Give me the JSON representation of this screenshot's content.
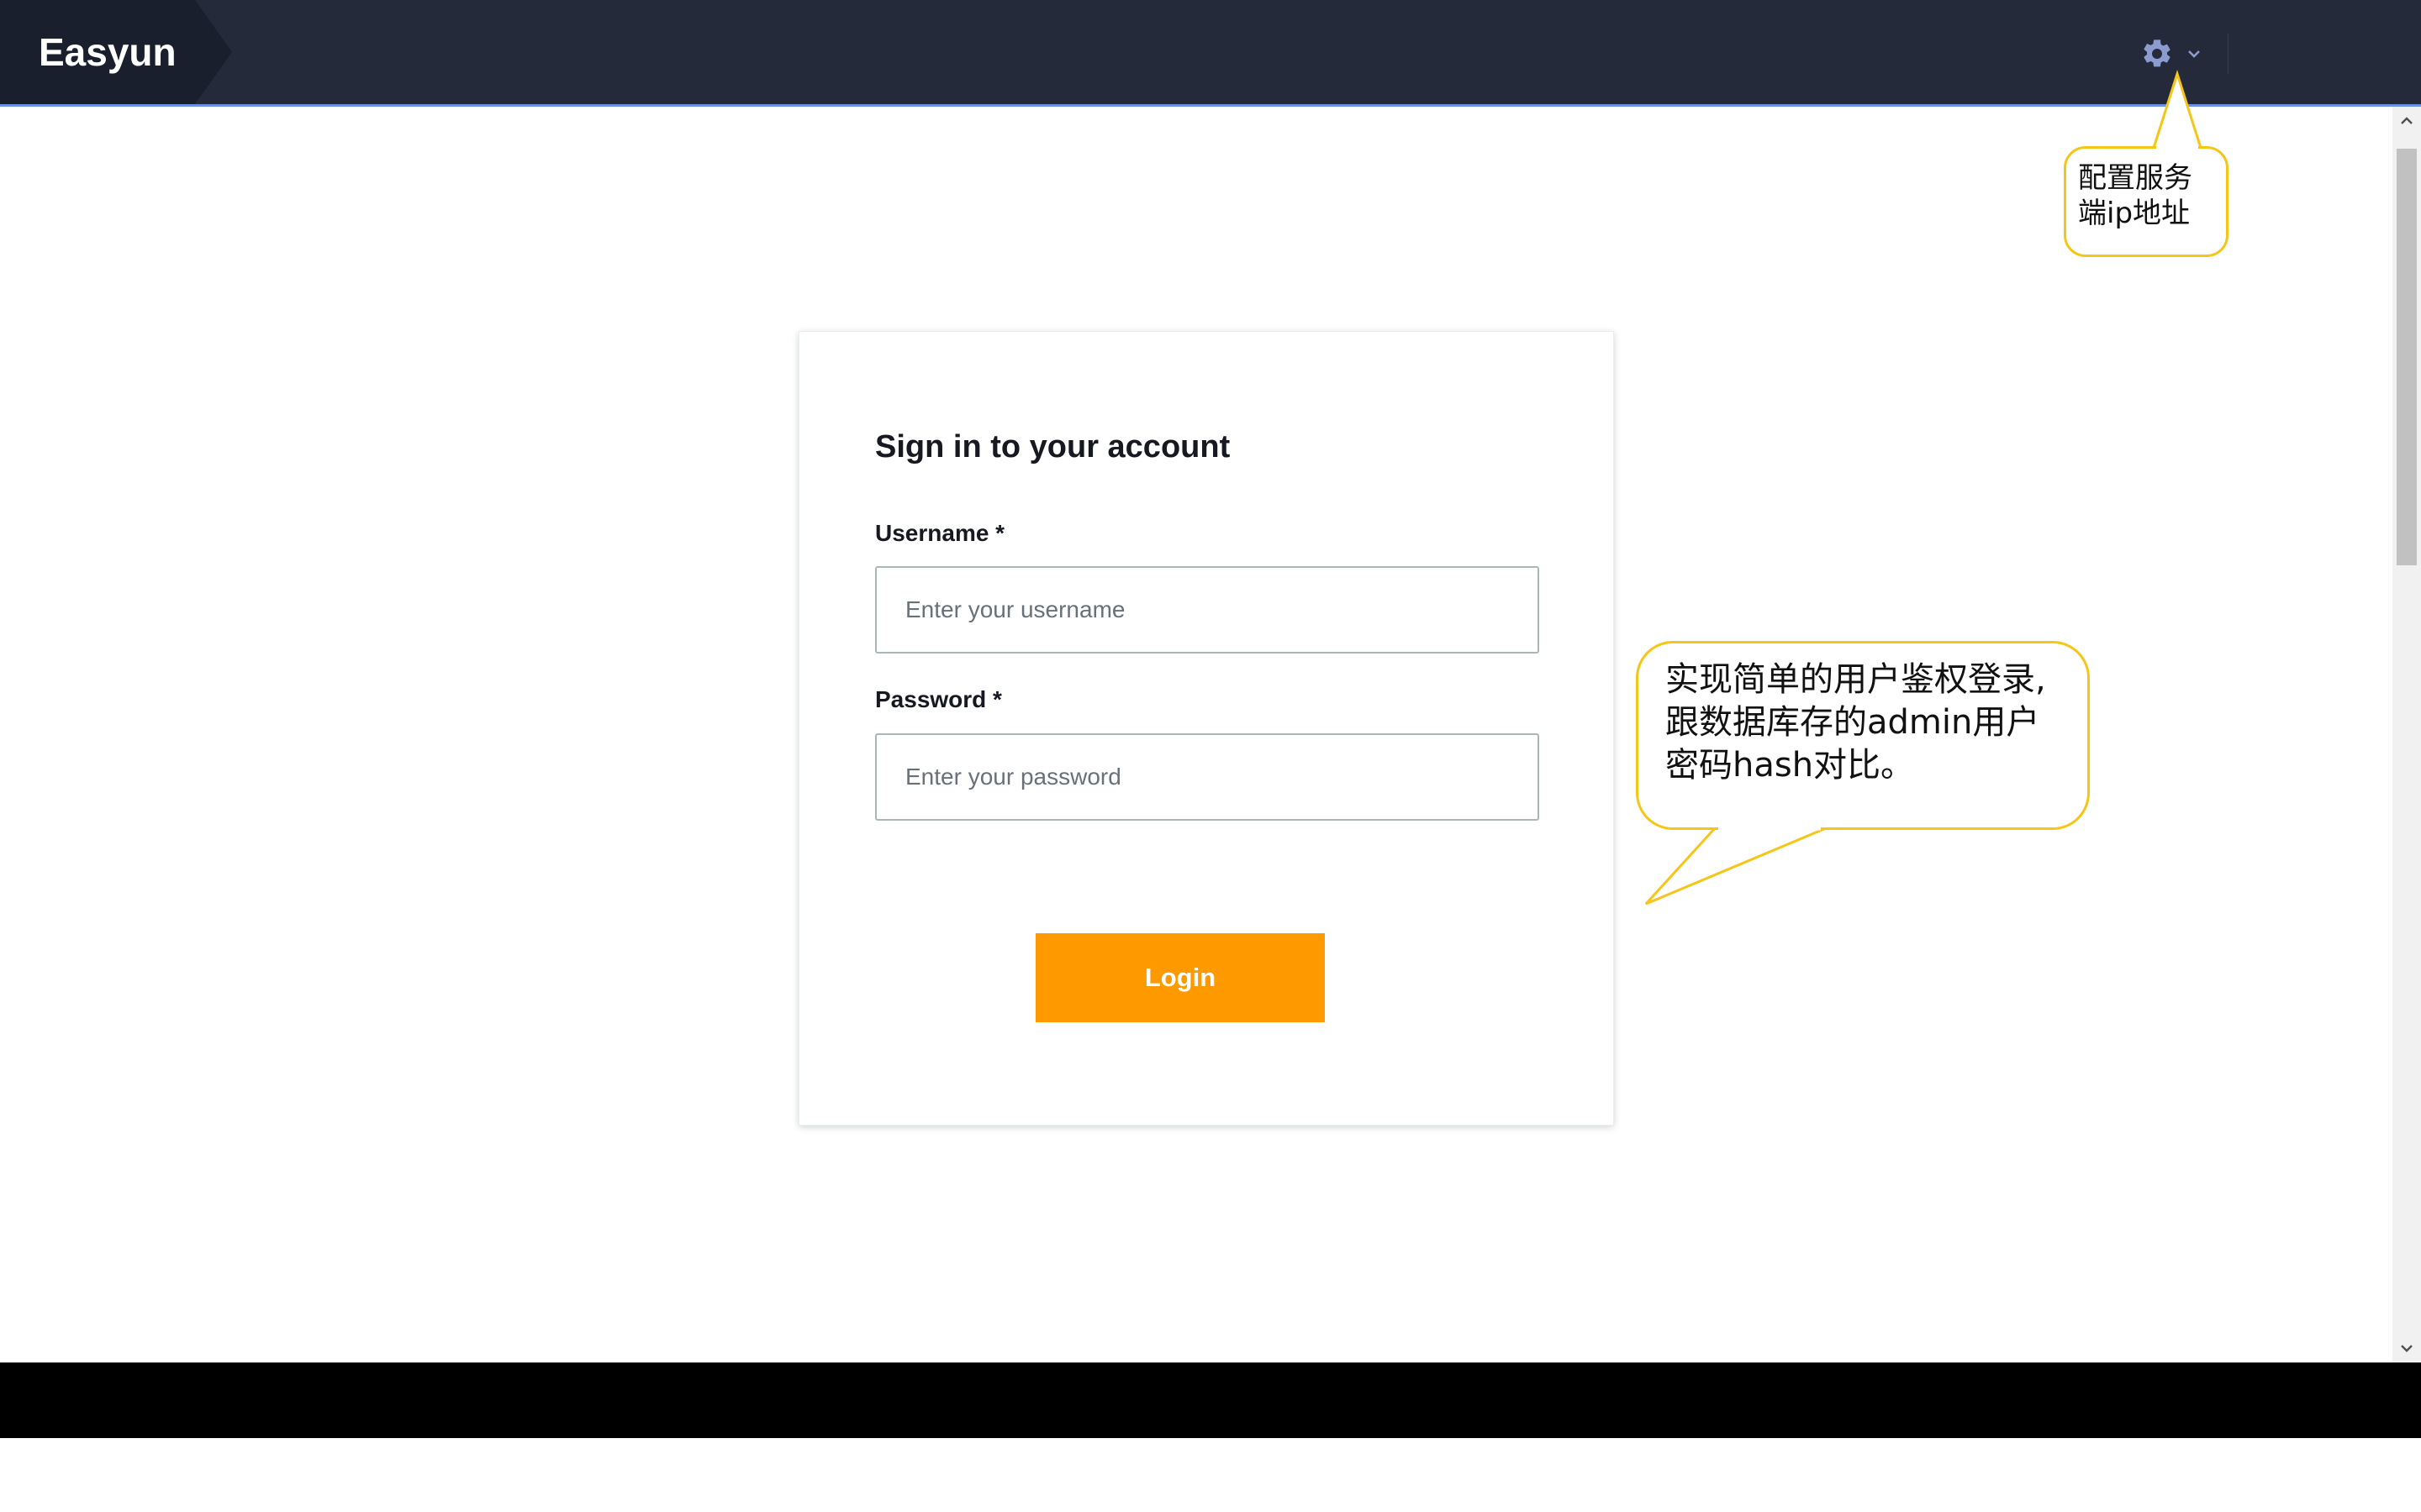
{
  "app": {
    "brand": "Easyun"
  },
  "header": {
    "settings_icon": "gear-icon",
    "dropdown_icon": "chevron-down-icon"
  },
  "login_form": {
    "title": "Sign in to your account",
    "username": {
      "label": "Username *",
      "placeholder": "Enter your username",
      "value": ""
    },
    "password": {
      "label": "Password *",
      "placeholder": "Enter your password",
      "value": ""
    },
    "submit_label": "Login"
  },
  "annotations": {
    "settings_note": "配置服务\n端ip地址",
    "login_note": "实现简单的用户鉴权登录,\n跟数据库存的admin用户\n密码hash对比。"
  },
  "colors": {
    "topbar": "#252a3b",
    "brand_box": "#1a1f2e",
    "accent_line": "#6d8fe0",
    "primary_button": "#ff9900",
    "callout_border": "#f5c518"
  }
}
